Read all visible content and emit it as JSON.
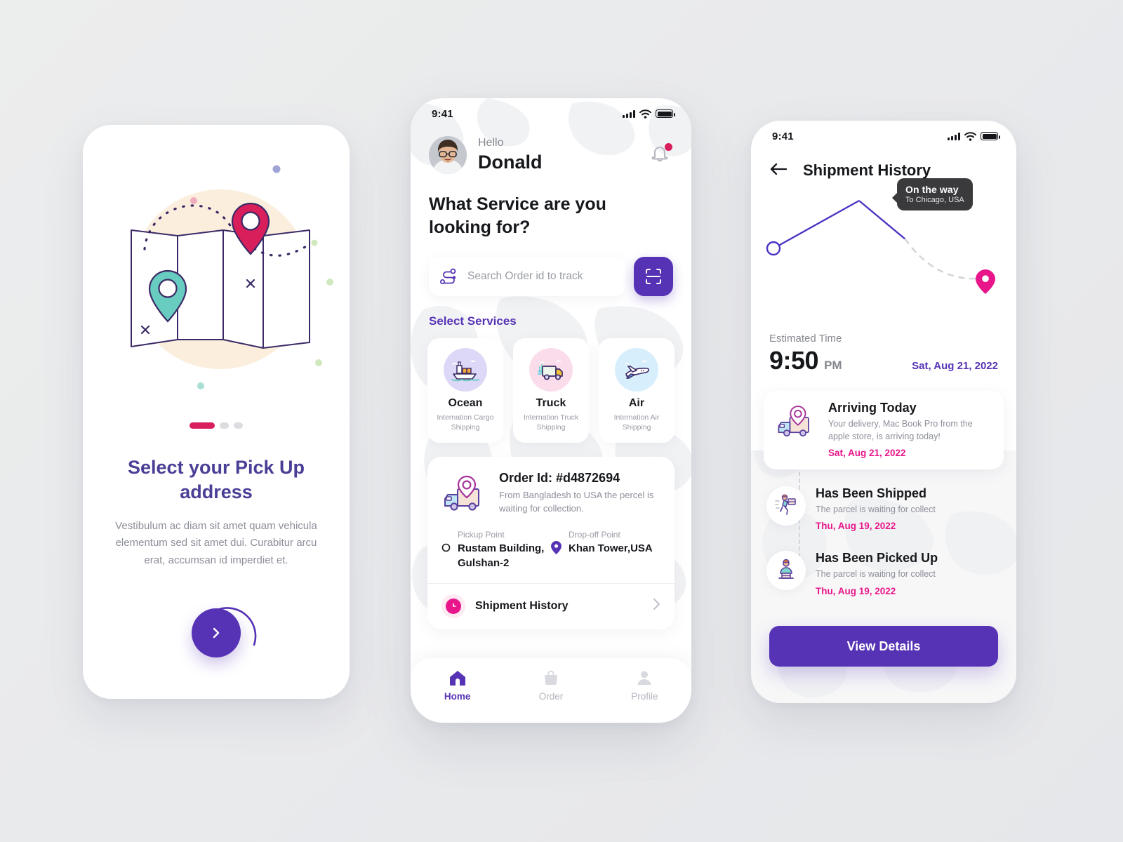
{
  "theme": {
    "purple": "#5633b5",
    "indigo_title": "#4a3f96",
    "crimson": "#d81e5b",
    "pink": "#e8168a",
    "dark": "#16181c",
    "muted": "#8d8f9a",
    "page_bg": "#eceded"
  },
  "screen1": {
    "name": "onboarding-pickup",
    "illustration": "folded-map-with-location-pins",
    "pager": {
      "total": 3,
      "active_index": 0
    },
    "title": "Select your Pick Up address",
    "body": "Vestibulum ac diam sit amet quam vehicula elementum sed sit amet dui. Curabitur arcu erat, accumsan id imperdiet et.",
    "next_button": {
      "icon": "chevron-right-icon",
      "label": ""
    }
  },
  "screen2": {
    "name": "home",
    "status_bar": {
      "time": "9:41",
      "signal": "cellular-signal-icon",
      "wifi": "wifi-icon",
      "battery": "battery-full-icon"
    },
    "header": {
      "avatar": "user-avatar",
      "greeting": "Hello",
      "user_name": "Donald",
      "notification": {
        "icon": "bell-icon",
        "has_badge": true
      }
    },
    "question": "What Service are you looking for?",
    "search": {
      "icon": "route-icon",
      "placeholder": "Search Order id to track",
      "value": ""
    },
    "scan_button": {
      "icon": "scan-icon",
      "label": ""
    },
    "services_label": "Select Services",
    "services": [
      {
        "icon": "cargo-ship-icon",
        "name": "Ocean",
        "desc": "Internation Cargo Shipping",
        "blob": "#ddd8f7"
      },
      {
        "icon": "delivery-truck-icon",
        "name": "Truck",
        "desc": "Internation Truck Shipping",
        "blob": "#fbdcea"
      },
      {
        "icon": "airplane-icon",
        "name": "Air",
        "desc": "Internation Air Shipping",
        "blob": "#d7eefc"
      }
    ],
    "order_card": {
      "icon": "truck-with-pin-icon",
      "order_id": "Order Id: #d4872694",
      "description": "From  Bangladesh to USA the percel is waiting for collection.",
      "pickup": {
        "icon": "circle-outline-icon",
        "label": "Pickup Point",
        "value": "Rustam Building, Gulshan-2"
      },
      "dropoff": {
        "icon": "map-pin-icon",
        "label": "Drop-off Point",
        "value": "Khan Tower,USA"
      },
      "history_row": {
        "icon": "clock-icon",
        "label": "Shipment History",
        "chevron": "chevron-right-icon"
      }
    },
    "tabs": [
      {
        "icon": "home-icon",
        "label": "Home",
        "active": true
      },
      {
        "icon": "bag-icon",
        "label": "Order",
        "active": false
      },
      {
        "icon": "person-icon",
        "label": "Profile",
        "active": false
      }
    ]
  },
  "screen3": {
    "name": "shipment-history",
    "status_bar": {
      "time": "9:41",
      "signal": "cellular-signal-icon",
      "wifi": "wifi-icon",
      "battery": "battery-full-icon"
    },
    "back_icon": "arrow-left-icon",
    "title": "Shipment History",
    "map": {
      "origin_marker": "circle-outline-marker",
      "destination_marker": "pink-map-pin",
      "tooltip": {
        "title": "On the way",
        "subtitle": "To Chicago, USA"
      }
    },
    "estimate": {
      "label": "Estimated Time",
      "time": "9:50",
      "meridiem": "PM",
      "date": "Sat, Aug 21, 2022"
    },
    "timeline": [
      {
        "icon": "truck-with-pin-icon",
        "title": "Arriving Today",
        "desc": "Your delivery, Mac Book Pro from the apple store, is arriving today!",
        "date": "Sat, Aug 21, 2022",
        "highlighted": true
      },
      {
        "icon": "courier-running-icon",
        "title": "Has Been Shipped",
        "desc": "The parcel is waiting for collect",
        "date": "Thu, Aug 19, 2022",
        "highlighted": false
      },
      {
        "icon": "worker-packing-icon",
        "title": "Has Been Picked Up",
        "desc": "The parcel is waiting for collect",
        "date": "Thu, Aug 19, 2022",
        "highlighted": false
      }
    ],
    "cta": {
      "label": "View Details"
    }
  }
}
